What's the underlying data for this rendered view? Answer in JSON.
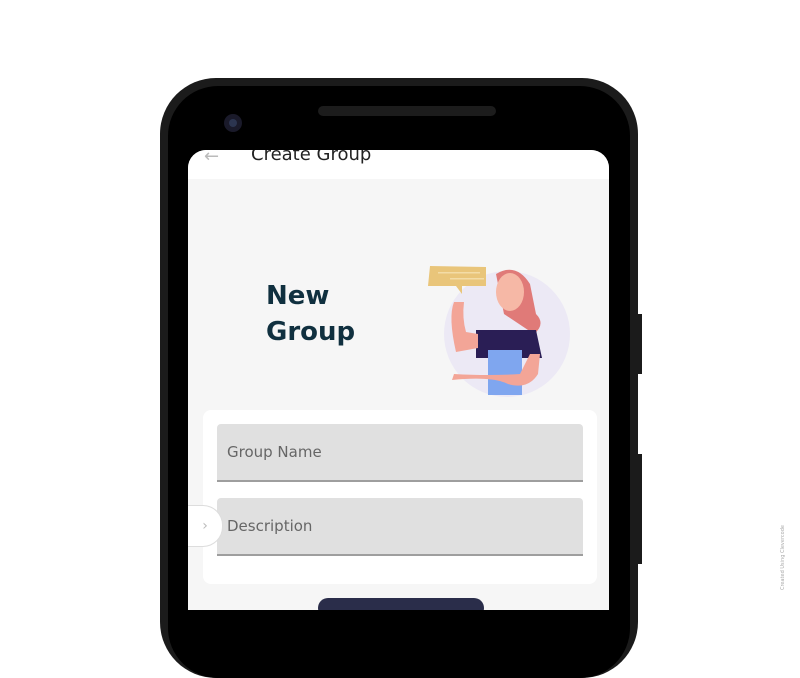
{
  "appbar": {
    "title": "Create Group",
    "back_icon": "arrow-left-icon"
  },
  "heading": "New Group",
  "form": {
    "group_name_placeholder": "Group Name",
    "description_placeholder": "Description"
  },
  "watermark": "Created Using Clevercode",
  "colors": {
    "heading": "#10303f",
    "field_bg": "#e0e0e0",
    "button": "#2a2d4a"
  }
}
